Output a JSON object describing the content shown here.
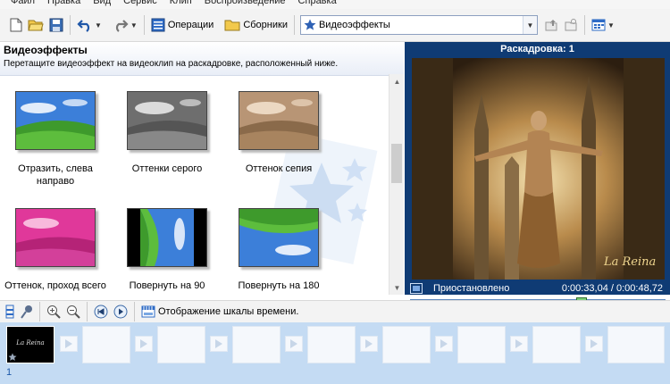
{
  "menu": [
    "Файл",
    "Правка",
    "Вид",
    "Сервис",
    "Клип",
    "Воспроизведение",
    "Справка"
  ],
  "toolbar": {
    "operations_label": "Операции",
    "collections_label": "Сборники",
    "collection_selected": "Видеоэффекты"
  },
  "effects_panel": {
    "title": "Видеоэффекты",
    "subtitle": "Перетащите видеоэффект на видеоклип на раскадровке, расположенный ниже.",
    "items": [
      {
        "label": "Отразить, слева направо"
      },
      {
        "label": "Оттенки серого"
      },
      {
        "label": "Оттенок сепия"
      },
      {
        "label": "Оттенок, проход всего"
      },
      {
        "label": "Повернуть на 90"
      },
      {
        "label": "Повернуть на 180"
      }
    ]
  },
  "preview": {
    "title": "Раскадровка: 1",
    "status": "Приостановлено",
    "time": "0:00:33,04 / 0:00:48,72",
    "video_caption": "La Reina",
    "seek_fraction": 0.68
  },
  "storyboard": {
    "timeline_label": "Отображение шкалы времени.",
    "clip_caption": "La Reina",
    "clip_number": "1"
  },
  "colors": {
    "preview_bg": "#0f3b74",
    "storyboard_bg": "#c4dbf3",
    "selection_accent": "#1c57a8"
  }
}
